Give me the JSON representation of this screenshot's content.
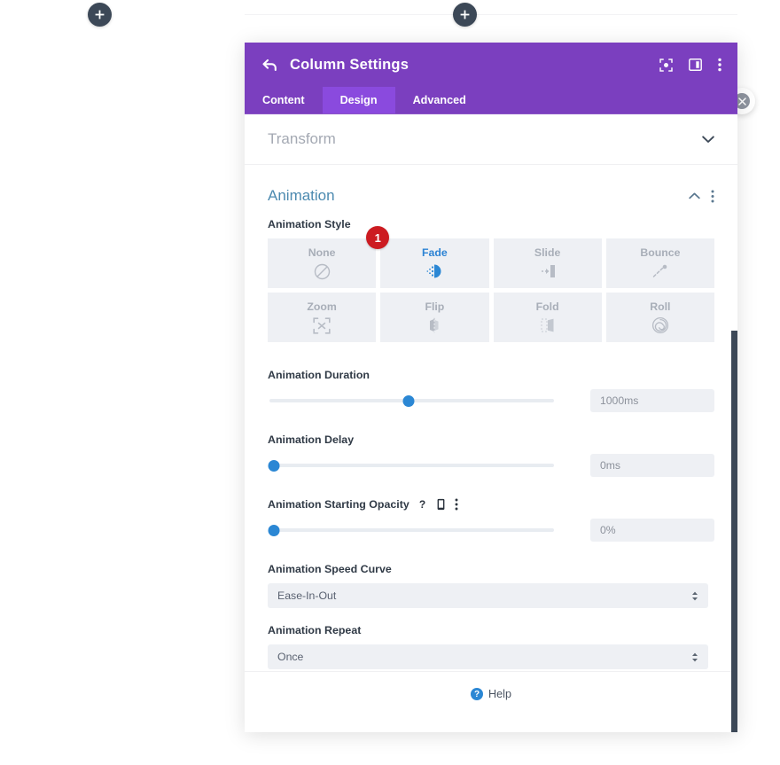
{
  "page": {
    "builder_add_left": "+",
    "builder_add_center": "+",
    "close_label": "×"
  },
  "modal": {
    "title": "Column Settings",
    "back_icon": "back-arrow-icon",
    "header_icons": [
      {
        "name": "focus-target-icon"
      },
      {
        "name": "panel-layout-icon"
      },
      {
        "name": "more-options-icon"
      }
    ],
    "tabs": [
      {
        "label": "Content",
        "active": false
      },
      {
        "label": "Design",
        "active": true
      },
      {
        "label": "Advanced",
        "active": false
      }
    ]
  },
  "sections": {
    "transform": {
      "title": "Transform",
      "expanded": false,
      "chevron": "chevron-down-icon"
    },
    "animation": {
      "title": "Animation",
      "expanded": true,
      "chevron": "chevron-up-icon",
      "more": "more-options-icon"
    }
  },
  "animation_style": {
    "label": "Animation Style",
    "badge": "1",
    "selected": "Fade",
    "options": [
      {
        "label": "None",
        "icon": "no-entry-icon",
        "selected": false
      },
      {
        "label": "Fade",
        "icon": "fade-dots-icon",
        "selected": true
      },
      {
        "label": "Slide",
        "icon": "slide-arrow-icon",
        "selected": false
      },
      {
        "label": "Bounce",
        "icon": "bounce-ball-icon",
        "selected": false
      },
      {
        "label": "Zoom",
        "icon": "zoom-expand-icon",
        "selected": false
      },
      {
        "label": "Flip",
        "icon": "flip-card-icon",
        "selected": false
      },
      {
        "label": "Fold",
        "icon": "fold-page-icon",
        "selected": false
      },
      {
        "label": "Roll",
        "icon": "roll-spiral-icon",
        "selected": false
      }
    ]
  },
  "duration": {
    "label": "Animation Duration",
    "value": "1000ms",
    "percent": 49
  },
  "delay": {
    "label": "Animation Delay",
    "value": "0ms",
    "percent": 1.5
  },
  "starting_opacity": {
    "label": "Animation Starting Opacity",
    "value": "0%",
    "percent": 1.5,
    "icons": [
      {
        "name": "help-question-icon",
        "glyph": "?"
      },
      {
        "name": "responsive-device-icon"
      },
      {
        "name": "more-options-icon"
      }
    ]
  },
  "speed_curve": {
    "label": "Animation Speed Curve",
    "value": "Ease-In-Out"
  },
  "repeat": {
    "label": "Animation Repeat",
    "value": "Once"
  },
  "help": {
    "label": "Help",
    "icon_glyph": "?"
  },
  "footer": {
    "buttons": [
      {
        "name": "cancel-button",
        "icon": "close-x-icon",
        "color": "#e8534c"
      },
      {
        "name": "undo-button",
        "icon": "undo-icon",
        "color": "#8a3fd4"
      },
      {
        "name": "redo-button",
        "icon": "redo-icon",
        "color": "#2482cf"
      },
      {
        "name": "save-button",
        "icon": "checkmark-icon",
        "color": "#2bbd9a"
      }
    ]
  },
  "colors": {
    "header_purple": "#7b3fbf",
    "tab_active_purple": "#8a4ade",
    "accent_blue": "#2b87d4",
    "badge_red": "#cc1b21",
    "section_title_blue": "#4c8ab0"
  }
}
